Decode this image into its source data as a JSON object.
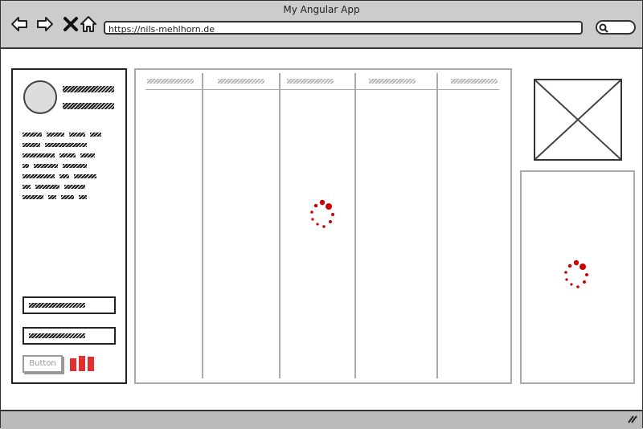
{
  "window": {
    "title": "My Angular App"
  },
  "toolbar": {
    "url": "https://nils-mehlhorn.de",
    "icons": [
      "back-arrow-icon",
      "forward-arrow-icon",
      "close-icon",
      "home-icon",
      "search-icon"
    ]
  },
  "sidebar": {
    "button_label": "Button",
    "accent": "#e03030"
  },
  "loading_color": "#cc0000"
}
